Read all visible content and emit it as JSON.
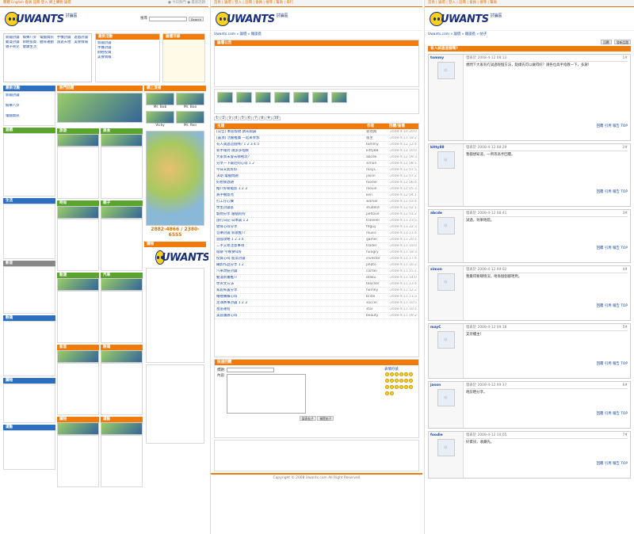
{
  "site": {
    "logo_word": "UWANTS",
    "logo_tag": "討論區",
    "logo_domain": ".com"
  },
  "panel1": {
    "topbar_nav": "簡體 English  會員 註冊 登入 網上購物 論壇",
    "topbar_right": "● 今日熱門 ● 最新話題",
    "search_label": "搜尋",
    "search_button": "Search",
    "sections": [
      "最新活動",
      "熱門話題",
      "論壇目錄",
      "網上直播",
      "遊戲",
      "生活",
      "影音",
      "數碼",
      "購物",
      "運動",
      "旅遊",
      "美食",
      "時尚",
      "親子",
      "動漫",
      "汽車"
    ],
    "hotline": "2882-4866 / 2380-6555",
    "user_names": [
      "Mr. Bob",
      "Mr. Boo",
      "Vicky",
      "Mr. Ron"
    ],
    "link_lines": [
      "新聞討論",
      "娛樂八卦",
      "電腦資訊",
      "手機討論",
      "遊戲討論",
      "動漫討論",
      "財經投資",
      "體育運動",
      "旅遊天地",
      "美食情報",
      "親子育兒",
      "健康生活"
    ]
  },
  "panel2": {
    "topbar_nav": "首頁 | 論壇 | 登入 | 註冊 | 會員 | 搜尋 | 幫助 | 排行",
    "breadcrumb": "Uwants.com » 論壇 » 雜談區",
    "notice_title": "論壇公告",
    "board_header": "主題",
    "col_author": "作者",
    "col_date": "回覆/查看",
    "thread_rows": [
      {
        "t": "[公告] 本區版規 請先閱讀",
        "a": "管理員",
        "d": "2008-4-10 20:03"
      },
      {
        "t": "[置頂] 活動推廣 一起來參加",
        "a": "版主",
        "d": "2008-4-11 18:22"
      },
      {
        "t": "有人試過這個嗎? 1 2 3 4 5",
        "a": "tommy",
        "d": "2008-4-12 12:45"
      },
      {
        "t": "新手報到 請多多指教",
        "a": "kitty88",
        "d": "2008-4-12 10:02"
      },
      {
        "t": "大家周末會去哪裡玩?",
        "a": "abcde",
        "d": "2008-4-12 09:31"
      },
      {
        "t": "分享一下最近的心得 1 2",
        "a": "simon",
        "d": "2008-4-12 08:14"
      },
      {
        "t": "今日天氣好好",
        "a": "mayC",
        "d": "2008-4-12 07:55"
      },
      {
        "t": "求助 電腦問題",
        "a": "jason",
        "d": "2008-4-12 07:20"
      },
      {
        "t": "好想食放題",
        "a": "foodie",
        "d": "2008-4-12 06:48"
      },
      {
        "t": "推介好睇電影 1 2 3",
        "a": "movie",
        "d": "2008-4-12 05:33"
      },
      {
        "t": "買手機意見",
        "a": "ken",
        "d": "2008-4-12 04:19"
      },
      {
        "t": "打工仔心聲",
        "a": "worker",
        "d": "2008-4-12 03:40"
      },
      {
        "t": "學生討論區",
        "a": "student",
        "d": "2008-4-12 02:11"
      },
      {
        "t": "寵物分享 貓貓狗狗",
        "a": "petlove",
        "d": "2008-4-12 01:25"
      },
      {
        "t": "旅行日記 日本篇 1 2",
        "a": "traveler",
        "d": "2008-4-11 23:58"
      },
      {
        "t": "健身心得分享",
        "a": "fitguy",
        "d": "2008-4-11 22:30"
      },
      {
        "t": "音樂討論 新歌推介",
        "a": "music",
        "d": "2008-4-11 21:47"
      },
      {
        "t": "遊戲攻略 1 2 3 4",
        "a": "gamer",
        "d": "2008-4-11 20:15"
      },
      {
        "t": "二手交易注意事項",
        "a": "trader",
        "d": "2008-4-11 19:02"
      },
      {
        "t": "閒聊 今晚食咩好",
        "a": "hungry",
        "d": "2008-4-11 18:33"
      },
      {
        "t": "投資心得 股票討論",
        "a": "investor",
        "d": "2008-4-11 17:48"
      },
      {
        "t": "攝影作品分享 1 2",
        "a": "photo",
        "d": "2008-4-11 16:22"
      },
      {
        "t": "汽車改裝討論",
        "a": "carfan",
        "d": "2008-4-11 15:10"
      },
      {
        "t": "動漫新番推介",
        "a": "otaku",
        "d": "2008-4-11 14:05"
      },
      {
        "t": "學英文方法",
        "a": "teacher",
        "d": "2008-4-11 13:41"
      },
      {
        "t": "家居佈置分享",
        "a": "homey",
        "d": "2008-4-11 12:20"
      },
      {
        "t": "婚禮籌備心得",
        "a": "bride",
        "d": "2008-4-11 11:37"
      },
      {
        "t": "足球賽事討論 1 2 3",
        "a": "soccer",
        "d": "2008-4-11 10:59"
      },
      {
        "t": "星座運程",
        "a": "star",
        "d": "2008-4-11 10:12"
      },
      {
        "t": "美容護膚心得",
        "a": "beauty",
        "d": "2008-4-11 09:25"
      }
    ],
    "quick_reply": "快速回覆",
    "subject_label": "標題:",
    "content_label": "內容:",
    "smilies_label": "表情符號",
    "post_button": "發表帖子",
    "preview_button": "預覽帖子",
    "footer": "Copyright © 2008 Uwants.com All Right Reserved"
  },
  "panel3": {
    "topbar_nav": "首頁 | 論壇 | 登入 | 註冊 | 會員 | 搜尋 | 幫助",
    "breadcrumb": "Uwants.com » 論壇 » 雜談區 » 帖子",
    "reply_button": "回覆",
    "new_button": "發新話題",
    "thread_title": "有人試過這個嗎?",
    "posts": [
      {
        "user": "tommy",
        "time": "發表於 2008-4-12 08:13",
        "floor": "1#",
        "body": "想問下大家有冇試過呢個方法，點樣先可以做得好？請各位高手指教一下，多謝！"
      },
      {
        "user": "kitty88",
        "time": "發表於 2008-4-12 08:29",
        "floor": "2#",
        "body": "我都想知道，一齊等高手回覆。"
      },
      {
        "user": "abcde",
        "time": "發表於 2008-4-12 08:41",
        "floor": "3#",
        "body": "試過，效果唔錯。"
      },
      {
        "user": "simon",
        "time": "發表於 2008-4-12 09:02",
        "floor": "4#",
        "body": "我覺得要睇情況，唔係個個都啱用。"
      },
      {
        "user": "mayC",
        "time": "發表於 2008-4-12 09:18",
        "floor": "5#",
        "body": "支持樓主！"
      },
      {
        "user": "jason",
        "time": "發表於 2008-4-12 09:37",
        "floor": "6#",
        "body": "唔該晒分享。"
      },
      {
        "user": "foodie",
        "time": "發表於 2008-4-12 10:05",
        "floor": "7#",
        "body": "好資訊，收藏先。"
      }
    ],
    "post_actions": "回覆 引用 報告",
    "top_link": "TOP"
  }
}
